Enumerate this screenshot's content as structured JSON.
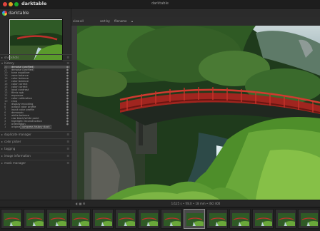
{
  "window": {
    "app_menu": "darktable",
    "title": "darktable"
  },
  "left": {
    "brand": "darktable",
    "sections_top": [
      {
        "label": "snapshots"
      },
      {
        "label": "history"
      }
    ],
    "history_items": [
      {
        "num": "22",
        "label": "denoise (profiled)",
        "mark": "●"
      },
      {
        "num": "21",
        "label": "denoise (profiled)",
        "mark": "●"
      },
      {
        "num": "20",
        "label": "tone equalizer",
        "mark": "●"
      },
      {
        "num": "19",
        "label": "zone balance",
        "mark": "●"
      },
      {
        "num": "18",
        "label": "color balance",
        "mark": "●"
      },
      {
        "num": "17",
        "label": "color balance",
        "mark": "●"
      },
      {
        "num": "16",
        "label": "color correct",
        "mark": "●"
      },
      {
        "num": "15",
        "label": "color correct",
        "mark": "●"
      },
      {
        "num": "14",
        "label": "local contrast",
        "mark": "●"
      },
      {
        "num": "13",
        "label": "filmic rgb",
        "mark": "●"
      },
      {
        "num": "12",
        "label": "exposure",
        "mark": "●"
      },
      {
        "num": "11",
        "label": "color calibration",
        "mark": "●"
      },
      {
        "num": "10",
        "label": "crop",
        "mark": "●"
      },
      {
        "num": "9",
        "label": "display encoding",
        "mark": "●"
      },
      {
        "num": "8",
        "label": "output color profile",
        "mark": "●"
      },
      {
        "num": "7",
        "label": "input color profile",
        "mark": "●"
      },
      {
        "num": "6",
        "label": "demosaic",
        "mark": "●"
      },
      {
        "num": "5",
        "label": "white balance",
        "mark": "●"
      },
      {
        "num": "4",
        "label": "raw black/white point",
        "mark": "●"
      },
      {
        "num": "3",
        "label": "highlight reconstruction",
        "mark": "●"
      },
      {
        "num": "2",
        "label": "orientation",
        "mark": "●"
      },
      {
        "num": "1",
        "label": "original",
        "mark": ""
      }
    ],
    "compress_button": "compress history stack",
    "sections_bottom": [
      {
        "label": "duplicate manager"
      },
      {
        "label": "color picker"
      },
      {
        "label": "tagging"
      },
      {
        "label": "image information"
      },
      {
        "label": "mask manager"
      }
    ]
  },
  "toolbar": {
    "view_label": "view",
    "view_value": "all",
    "sort_label": "sort by",
    "sort_value": "filename",
    "sort_dir": "▴"
  },
  "status": {
    "icons": "◐ ▦ ⚙",
    "info": "1/125 s • f/8.0 • 18 mm • ISO 400"
  },
  "filmstrip": {
    "count": 14,
    "active_index": 8
  }
}
